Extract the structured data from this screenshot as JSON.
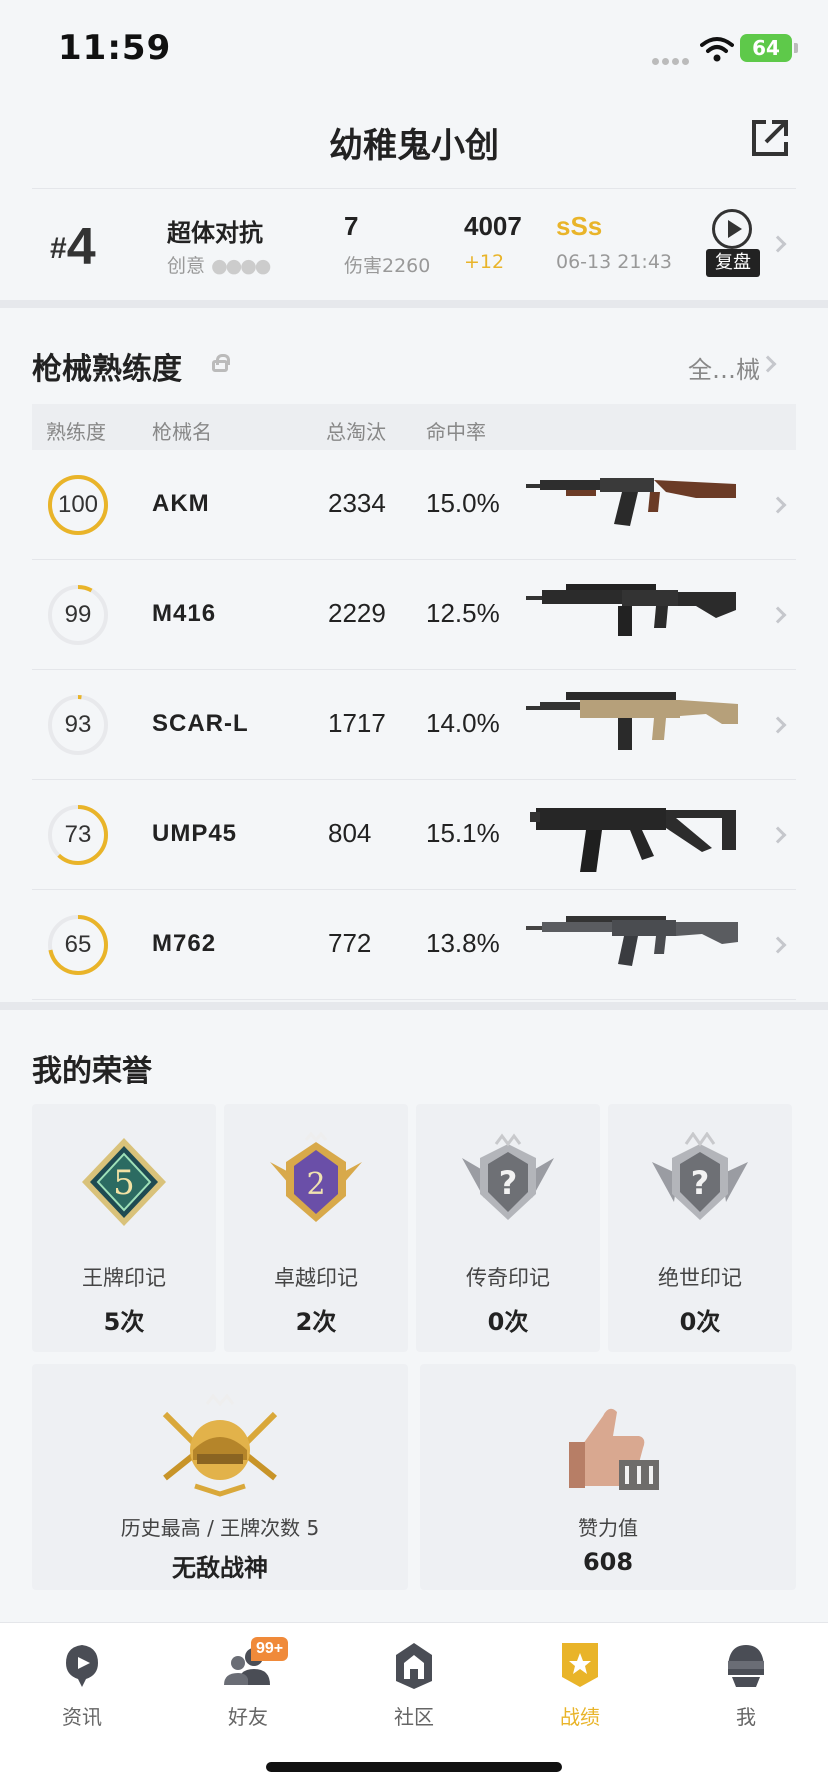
{
  "status_bar": {
    "time": "11:59",
    "battery": "64"
  },
  "header": {
    "title": "幼稚鬼小创"
  },
  "match": {
    "rank_prefix": "#",
    "rank": "4",
    "mode": "超体对抗",
    "mode_sub": "创意",
    "kills": "7",
    "damage": "伤害2260",
    "score": "4007",
    "score_delta": "+12",
    "grade": "sSs",
    "time": "06-13 21:43",
    "replay_label": "复盘"
  },
  "weapons": {
    "title": "枪械熟练度",
    "all_label": "全…械",
    "columns": [
      "熟练度",
      "枪械名",
      "总淘汰",
      "命中率"
    ],
    "rows": [
      {
        "level": "100",
        "progress": 1.0,
        "name": "AKM",
        "kills": "2334",
        "hit_rate": "15.0%"
      },
      {
        "level": "99",
        "progress": 0.08,
        "name": "M416",
        "kills": "2229",
        "hit_rate": "12.5%"
      },
      {
        "level": "93",
        "progress": 0.02,
        "name": "SCAR-L",
        "kills": "1717",
        "hit_rate": "14.0%"
      },
      {
        "level": "73",
        "progress": 0.62,
        "name": "UMP45",
        "kills": "804",
        "hit_rate": "15.1%"
      },
      {
        "level": "65",
        "progress": 0.72,
        "name": "M762",
        "kills": "772",
        "hit_rate": "13.8%"
      }
    ]
  },
  "honors": {
    "title": "我的荣誉",
    "items": [
      {
        "label": "王牌印记",
        "count": "5次",
        "badge_number": "5"
      },
      {
        "label": "卓越印记",
        "count": "2次",
        "badge_number": "2"
      },
      {
        "label": "传奇印记",
        "count": "0次",
        "badge_number": "?"
      },
      {
        "label": "绝世印记",
        "count": "0次",
        "badge_number": "?"
      }
    ],
    "history": {
      "label": "历史最高 / 王牌次数 5",
      "value": "无敌战神"
    },
    "likes": {
      "label": "赞力值",
      "value": "608"
    }
  },
  "tabbar": {
    "tabs": [
      {
        "label": "资讯",
        "icon": "news-icon"
      },
      {
        "label": "好友",
        "icon": "friends-icon",
        "badge": "99+"
      },
      {
        "label": "社区",
        "icon": "community-icon"
      },
      {
        "label": "战绩",
        "icon": "record-icon",
        "active": true
      },
      {
        "label": "我",
        "icon": "profile-icon"
      }
    ]
  },
  "colors": {
    "accent": "#e9b429",
    "badge": "#f08a3a",
    "battery": "#5ec94a"
  }
}
